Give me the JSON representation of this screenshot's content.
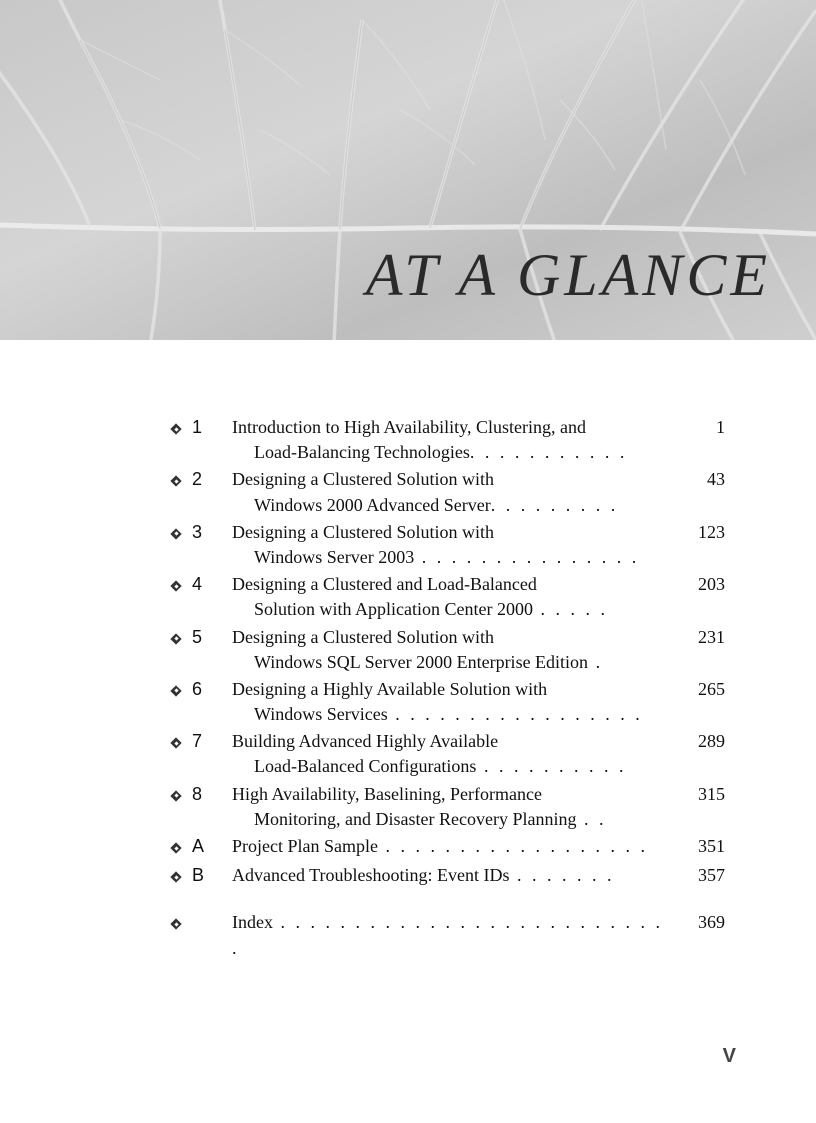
{
  "banner": {
    "title": "AT A GLANCE"
  },
  "toc": {
    "entries": [
      {
        "num": "1",
        "line1": "Introduction to High Availability, Clustering, and",
        "line2": "Load-Balancing Technologies",
        "dots": ". . . . . . . . . . .",
        "page": "1"
      },
      {
        "num": "2",
        "line1": "Designing a Clustered Solution with",
        "line2": "Windows 2000 Advanced Server",
        "dots": ". . . . . . . . .",
        "page": "43"
      },
      {
        "num": "3",
        "line1": "Designing a Clustered Solution with",
        "line2": "Windows Server 2003",
        "dots": "  . . . . . . . . . . . . . . .",
        "page": "123"
      },
      {
        "num": "4",
        "line1": "Designing a Clustered and Load-Balanced",
        "line2": "Solution with Application Center 2000",
        "dots": "  . . . . .",
        "page": "203"
      },
      {
        "num": "5",
        "line1": "Designing a Clustered Solution with",
        "line2": "Windows SQL Server 2000 Enterprise Edition",
        "dots": "  .",
        "page": "231"
      },
      {
        "num": "6",
        "line1": "Designing a Highly Available Solution with",
        "line2": "Windows Services",
        "dots": "  . . . . . . . . . . . . . . . . .",
        "page": "265"
      },
      {
        "num": "7",
        "line1": "Building Advanced Highly Available",
        "line2": "Load-Balanced Configurations",
        "dots": "  . . . . . . . . . .",
        "page": "289"
      },
      {
        "num": "8",
        "line1": "High Availability, Baselining, Performance",
        "line2": "Monitoring, and Disaster Recovery Planning",
        "dots": " . .",
        "page": "315"
      },
      {
        "num": "A",
        "line1": "Project Plan Sample",
        "line2": "",
        "dots": "  . . . . . . . . . . . . . . . . . .",
        "page": "351"
      },
      {
        "num": "B",
        "line1": "Advanced Troubleshooting: Event IDs",
        "line2": "",
        "dots": " . . . . . . .",
        "page": "357"
      },
      {
        "gap": true
      },
      {
        "num": "",
        "line1": "Index",
        "line2": "",
        "dots": "  . . . . . . . . . . . . . . . . . . . . . . . . . . .",
        "page": "369"
      }
    ]
  },
  "pageNumber": "V"
}
